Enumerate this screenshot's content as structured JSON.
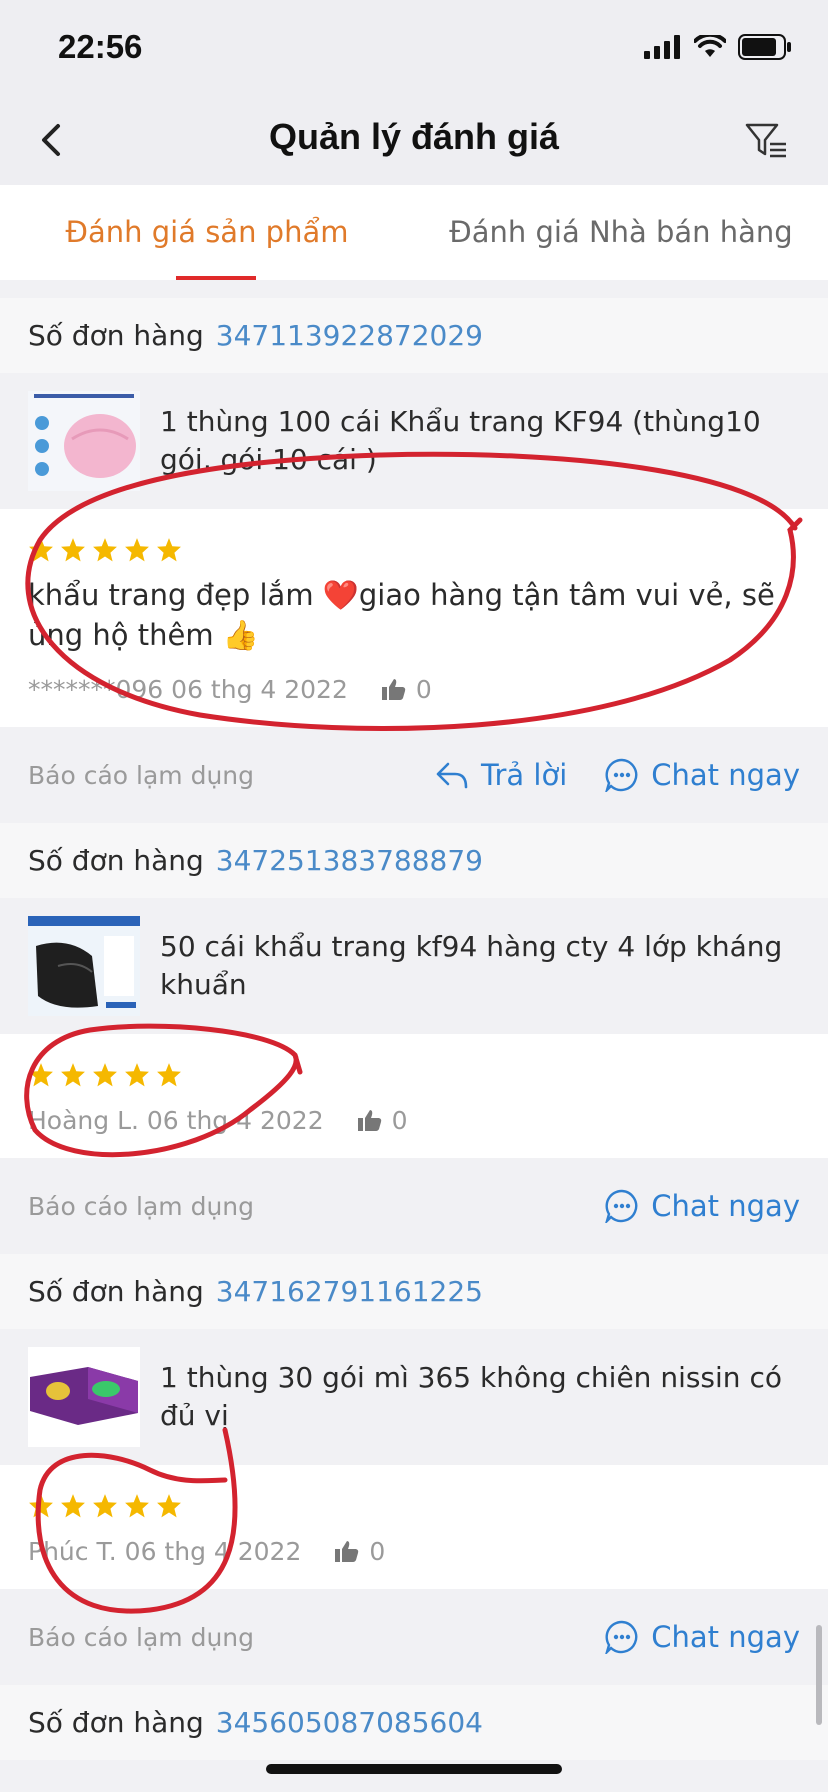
{
  "status_bar": {
    "time": "22:56"
  },
  "header": {
    "title": "Quản lý đánh giá"
  },
  "tabs": [
    {
      "label": "Đánh giá sản phẩm",
      "active": true
    },
    {
      "label": "Đánh giá Nhà bán hàng",
      "active": false
    }
  ],
  "colors": {
    "accent_orange": "#e07a2a",
    "link_blue": "#2f7fd0",
    "star": "#f5b800",
    "annotation_red": "#d3232f"
  },
  "reviews": [
    {
      "order_label": "Số đơn hàng",
      "order_number": "347113922872029",
      "product_name": "1 thùng 100 cái Khẩu trang KF94 (thùng10 gói, gói 10 cái )",
      "rating": 5,
      "text": "khẩu trang đẹp lắm ❤️giao hàng tận tâm vui vẻ, sẽ ủng hộ thêm 👍",
      "reviewer": "*******096",
      "date": "06 thg 4 2022",
      "likes": "0",
      "report": "Báo cáo lạm dụng",
      "reply": "Trả lời",
      "chat": "Chat ngay"
    },
    {
      "order_label": "Số đơn hàng",
      "order_number": "347251383788879",
      "product_name": "50 cái khẩu trang kf94 hàng cty 4 lớp kháng khuẩn",
      "rating": 5,
      "reviewer": "Hoàng L.",
      "date": "06 thg 4 2022",
      "likes": "0",
      "report": "Báo cáo lạm dụng",
      "chat": "Chat ngay"
    },
    {
      "order_label": "Số đơn hàng",
      "order_number": "347162791161225",
      "product_name": "1 thùng 30 gói mì 365 không chiên nissin có đủ vị",
      "rating": 5,
      "reviewer": "Phúc T.",
      "date": "06 thg 4 2022",
      "likes": "0",
      "report": "Báo cáo lạm dụng",
      "chat": "Chat ngay"
    }
  ],
  "next_order": {
    "order_label": "Số đơn hàng",
    "order_number": "345605087085604"
  }
}
